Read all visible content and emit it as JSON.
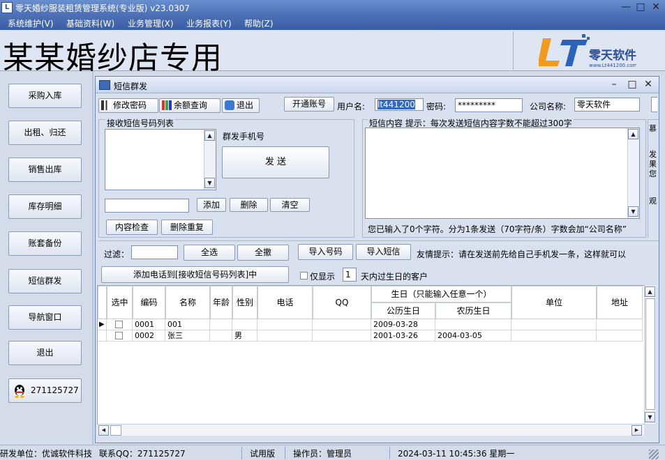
{
  "window": {
    "title": "零天婚纱服装租赁管理系统(专业版)  v23.0307",
    "app_icon": "L"
  },
  "menu": [
    "系统维护(V)",
    "基础资料(W)",
    "业务管理(X)",
    "业务报表(Y)",
    "帮助(Z)"
  ],
  "banner": {
    "store_name": "某某婚纱店专用",
    "logo_text": "零天软件",
    "logo_url": "www.Lt441200.com"
  },
  "nav": [
    "采购入库",
    "出租、归还",
    "销售出库",
    "库存明细",
    "账套备份",
    "短信群发",
    "导航窗口",
    "退出"
  ],
  "qq_number": "271125727",
  "sms": {
    "title": "短信群发",
    "toolbar": {
      "change_pwd": "修改密码",
      "balance": "余额查询",
      "exit": "退出",
      "open_account": "开通账号",
      "username_label": "用户名:",
      "username": "lt441200",
      "password_label": "密码:",
      "password": "*********",
      "company_label": "公司名称:",
      "company": "零天软件"
    },
    "recv_list_title": "接收短信号码列表",
    "mass_label": "群发手机号",
    "send": "发  送",
    "add": "添加",
    "delete": "删除",
    "clear": "清空",
    "check": "内容检查",
    "dedupe": "删除重复",
    "content_title": "短信内容 提示：每次发送短信内容字数不能超过300字",
    "content_status": "您已输入了0个字符。分为1条发送（70字符/条）字数会加“公司名称”",
    "side_chars": [
      "慕",
      "发",
      "果",
      "您",
      "观"
    ],
    "filter_label": "过滤：",
    "select_all": "全选",
    "deselect_all": "全撤",
    "import_numbers": "导入号码",
    "import_sms": "导入短信",
    "tip": "友情提示：请在发送前先给自己手机发一条，这样就可以",
    "add_to_list": "添加电话到[接收短信号码列表]中",
    "birthday_prefix": "仅显示",
    "birthday_days": "1",
    "birthday_suffix": "天内过生日的客户"
  },
  "grid": {
    "headers": {
      "select": "选中",
      "code": "编码",
      "name": "名称",
      "age": "年龄",
      "gender": "性别",
      "phone": "电话",
      "qq": "QQ",
      "birthday_group": "生日（只能输入任意一个）",
      "solar": "公历生日",
      "lunar": "农历生日",
      "unit": "单位",
      "address": "地址"
    },
    "rows": [
      {
        "code": "0001",
        "name": "001",
        "age": "",
        "gender": "",
        "phone": "",
        "qq": "",
        "solar": "2009-03-28",
        "lunar": "",
        "unit": "",
        "address": ""
      },
      {
        "code": "0002",
        "name": "张三",
        "age": "",
        "gender": "男",
        "phone": "",
        "qq": "",
        "solar": "2001-03-26",
        "lunar": "2004-03-05",
        "unit": "",
        "address": ""
      }
    ]
  },
  "status": {
    "company": "研发单位：优诚软件科技",
    "qq": "联系QQ：271125727",
    "edition": "试用版",
    "operator": "操作员：管理员",
    "datetime": "2024-03-11 10:45:36 星期一"
  }
}
